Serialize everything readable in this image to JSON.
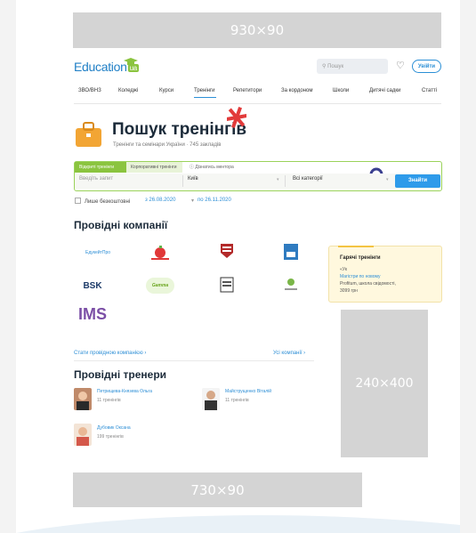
{
  "ads": {
    "top": "930×90",
    "side": "240×400",
    "bottom": "730×90"
  },
  "header": {
    "logo_text": "Education",
    "logo_badge": "ua",
    "search_placeholder": "Пошук",
    "login_label": "Увійти"
  },
  "nav": [
    "ЗВО/ВНЗ",
    "Коледжі",
    "Курси",
    "Тренінги",
    "Репетитори",
    "За кордоном",
    "Школи",
    "Дитячі садки",
    "Статті"
  ],
  "nav_active": "Тренінги",
  "hero": {
    "title": "Пошук тренінгів",
    "subtitle": "Тренінги та семінари України · 745 закладів"
  },
  "filter": {
    "tabs": [
      "Відкриті тренінги",
      "Корпоративні тренінги",
      "Дізнатись ментора"
    ],
    "search_placeholder": "Введіть запит",
    "city": "Київ",
    "category": "Всі категорії",
    "button": "Знайти"
  },
  "options": {
    "free_only": "Лише безкоштовні",
    "date_from": "з 26.08.2020",
    "date_to": "по 26.11.2020"
  },
  "companies": {
    "title": "Провідні компанії",
    "logos": [
      "ЕдукейтПро",
      "Apple-logo",
      "Shield-logo",
      "Blue-logo",
      "BSK",
      "Gamma",
      "Book-logo",
      "Green-logo",
      "IMS"
    ],
    "become_link": "Стати провідною компанією ›",
    "all_link": "Усі компанії ›"
  },
  "hot": {
    "title": "Гарячі тренінги",
    "line1": "«Ук",
    "line2": "Магістри по новому",
    "line3": "Profitum, школа свідомості,",
    "line4": "3099 грн"
  },
  "trainers": {
    "title": "Провідні тренери",
    "items": [
      {
        "name": "Петрищева-Князева Ольга",
        "count": "11 тренінгів"
      },
      {
        "name": "Майструщенко Віталій",
        "count": "11 тренінгів"
      },
      {
        "name": "Дубовик Оксана",
        "count": "199 тренінгів"
      }
    ]
  }
}
